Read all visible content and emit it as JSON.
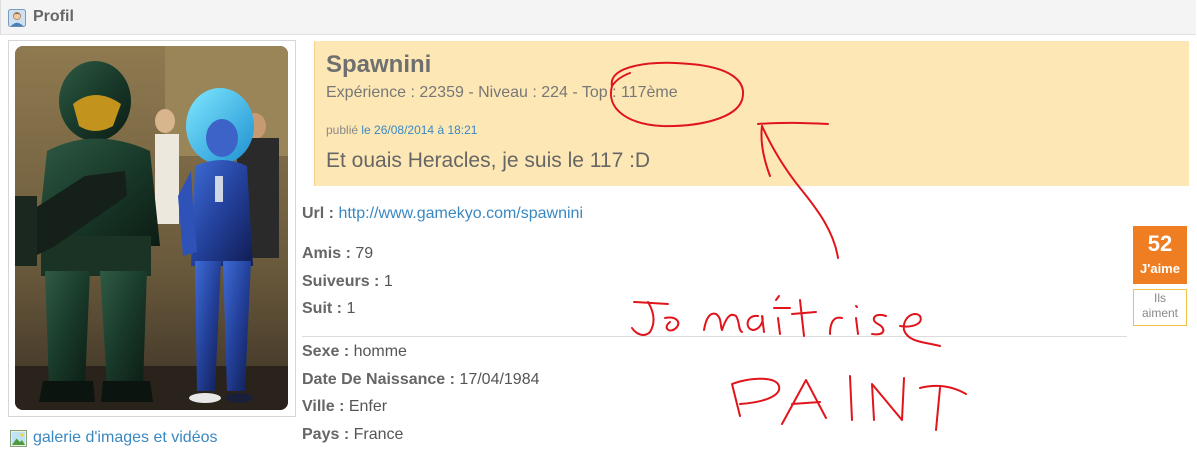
{
  "header": {
    "title": "Profil",
    "icon": "user-avatar-icon"
  },
  "gallery": {
    "label": "galerie d'images et vidéos",
    "icon": "image-icon"
  },
  "post": {
    "username": "Spawnini",
    "stats": "Expérience : 22359 - Niveau : 224 - Top : 117ème",
    "published_prefix": "publié",
    "published_date": "le 26/08/2014 à 18:21",
    "status": "Et ouais Heracles, je suis le 117 :D"
  },
  "profile": {
    "url_label": "Url :",
    "url_value": "http://www.gamekyo.com/spawnini",
    "amis_label": "Amis :",
    "amis_value": "79",
    "suiveurs_label": "Suiveurs :",
    "suiveurs_value": "1",
    "suit_label": "Suit :",
    "suit_value": "1",
    "sexe_label": "Sexe :",
    "sexe_value": "homme",
    "naissance_label": "Date De Naissance :",
    "naissance_value": "17/04/1984",
    "ville_label": "Ville :",
    "ville_value": "Enfer",
    "pays_label": "Pays :",
    "pays_value": "France"
  },
  "like": {
    "count": "52",
    "label": "J'aime",
    "they_like_1": "Ils",
    "they_like_2": "aiment"
  },
  "annotation": {
    "line1": "Je maîtrise",
    "line2": "PAINT",
    "color": "#e0151b"
  }
}
